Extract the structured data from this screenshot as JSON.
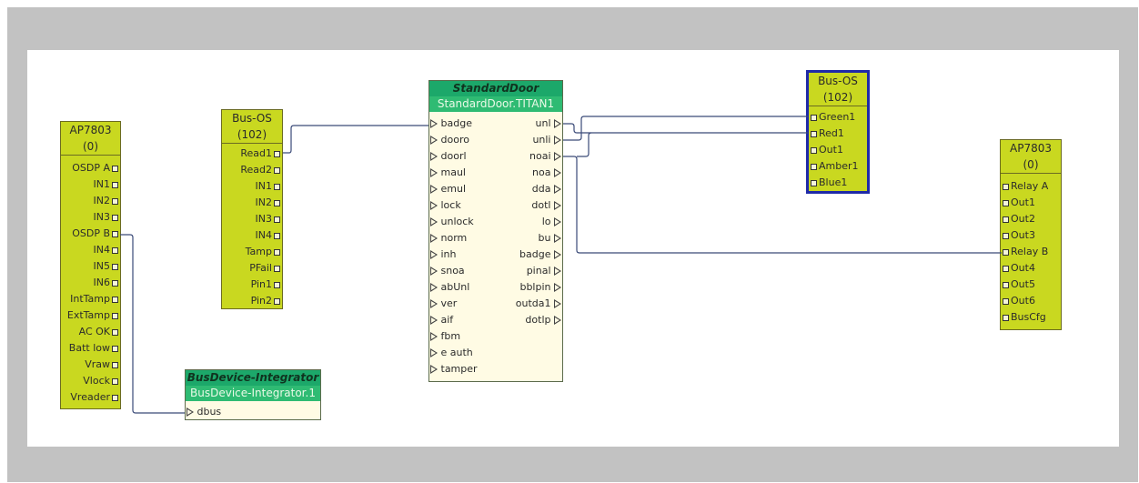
{
  "blocks": {
    "ap_left": {
      "title": "AP7803",
      "subtitle": "(0)",
      "ports": [
        "OSDP A",
        "IN1",
        "IN2",
        "IN3",
        "OSDP B",
        "IN4",
        "IN5",
        "IN6",
        "IntTamp",
        "ExtTamp",
        "AC OK",
        "Batt low",
        "Vraw",
        "Vlock",
        "Vreader"
      ]
    },
    "busos_left": {
      "title": "Bus-OS",
      "subtitle": "(102)",
      "ports": [
        "Read1",
        "Read2",
        "IN1",
        "IN2",
        "IN3",
        "IN4",
        "Tamp",
        "PFail",
        "Pin1",
        "Pin2"
      ]
    },
    "standard_door": {
      "title": "StandardDoor",
      "subtitle": "StandardDoor.TITAN1",
      "inputs": [
        "badge",
        "dooro",
        "doorl",
        "maul",
        "emul",
        "lock",
        "unlock",
        "norm",
        "inh",
        "snoa",
        "abUnl",
        "ver",
        "aif",
        "fbm",
        "e auth",
        "tamper"
      ],
      "outputs": [
        "unl",
        "unli",
        "noai",
        "noa",
        "dda",
        "dotl",
        "lo",
        "bu",
        "badge",
        "pinal",
        "bblpin",
        "outda1",
        "dotlp"
      ]
    },
    "bus_integrator": {
      "title": "BusDevice-Integrator",
      "subtitle": "BusDevice-Integrator.1",
      "inputs": [
        "dbus"
      ]
    },
    "busos_right": {
      "title": "Bus-OS",
      "subtitle": "(102)",
      "ports": [
        "Green1",
        "Red1",
        "Out1",
        "Amber1",
        "Blue1"
      ]
    },
    "ap_right": {
      "title": "AP7803",
      "subtitle": "(0)",
      "ports": [
        "Relay A",
        "Out1",
        "Out2",
        "Out3",
        "Relay B",
        "Out4",
        "Out5",
        "Out6",
        "BusCfg"
      ]
    }
  },
  "colors": {
    "frame": "#c2c2c2",
    "block_fill": "#c9d820",
    "function_header": "#1ca86a",
    "function_body": "#fffbe4",
    "wire": "#3a4a78",
    "selection_border": "#1f2aa8"
  }
}
